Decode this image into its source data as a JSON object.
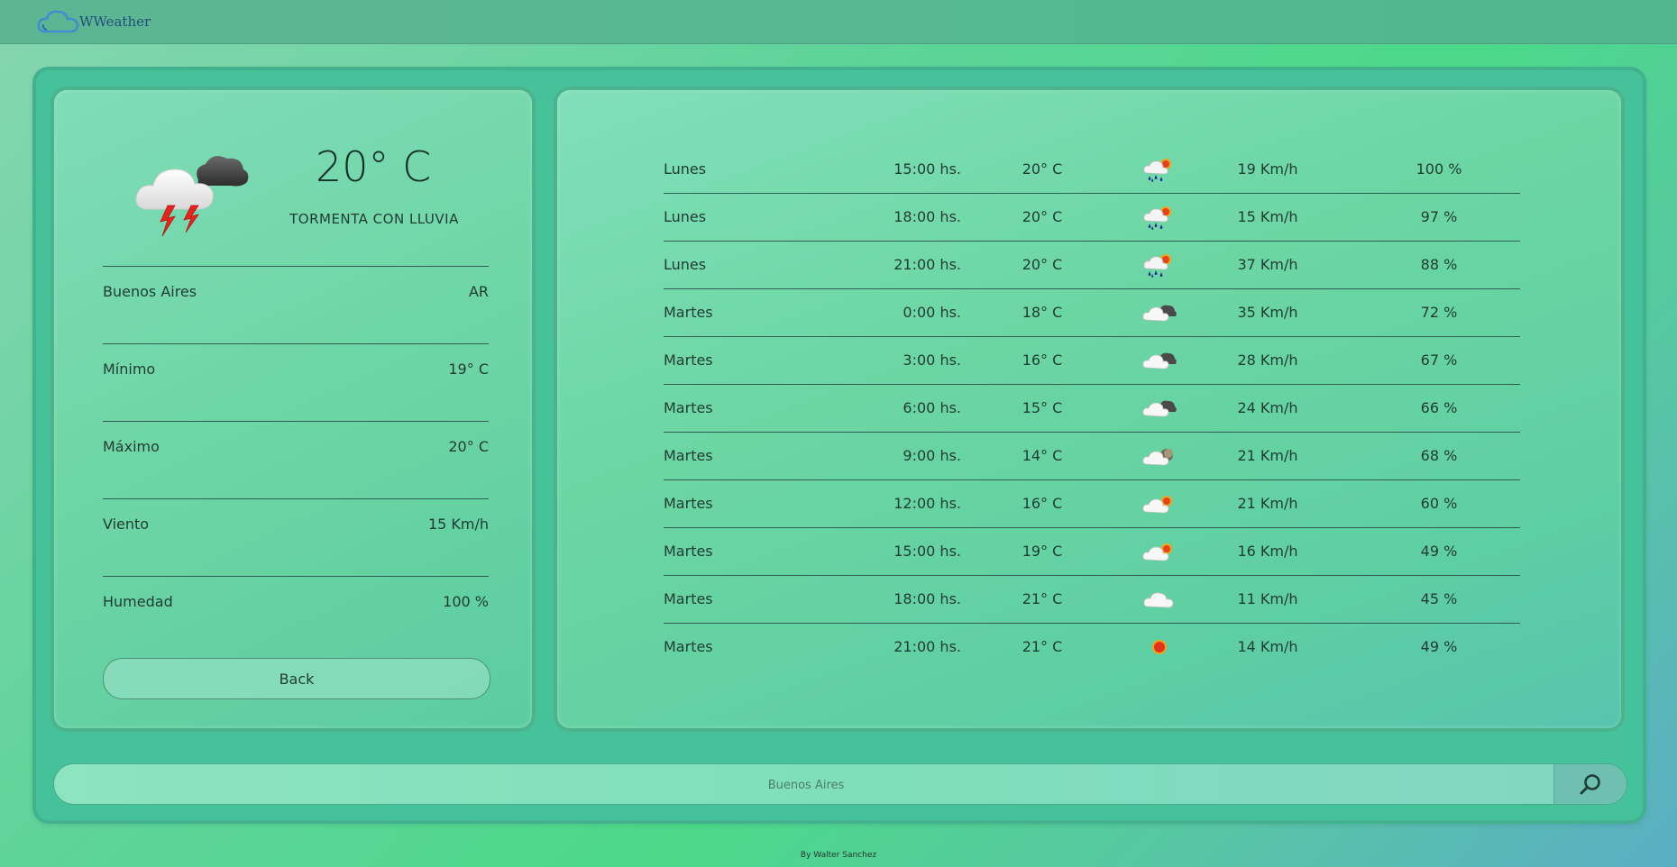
{
  "header": {
    "brand": "WWeather",
    "logo_icon": "cloud-icon"
  },
  "current": {
    "icon": "thunderstorm-icon",
    "temperature": "20° C",
    "description": "TORMENTA CON LLUVIA",
    "stats": [
      {
        "label": "Buenos Aires",
        "value": "AR"
      },
      {
        "label": "Mínimo",
        "value": "19° C"
      },
      {
        "label": "Máximo",
        "value": "20° C"
      },
      {
        "label": "Viento",
        "value": "15 Km/h"
      },
      {
        "label": "Humedad",
        "value": "100 %"
      }
    ],
    "back_label": "Back"
  },
  "forecast": [
    {
      "day": "Lunes",
      "time": "15:00 hs.",
      "temp": "20° C",
      "icon": "rain-sun-icon",
      "wind": "19 Km/h",
      "humidity": "100 %"
    },
    {
      "day": "Lunes",
      "time": "18:00 hs.",
      "temp": "20° C",
      "icon": "rain-sun-icon",
      "wind": "15 Km/h",
      "humidity": "97 %"
    },
    {
      "day": "Lunes",
      "time": "21:00 hs.",
      "temp": "20° C",
      "icon": "rain-sun-icon",
      "wind": "37 Km/h",
      "humidity": "88 %"
    },
    {
      "day": "Martes",
      "time": "0:00 hs.",
      "temp": "18° C",
      "icon": "cloudy-night-icon",
      "wind": "35 Km/h",
      "humidity": "72 %"
    },
    {
      "day": "Martes",
      "time": "3:00 hs.",
      "temp": "16° C",
      "icon": "cloudy-night-icon",
      "wind": "28 Km/h",
      "humidity": "67 %"
    },
    {
      "day": "Martes",
      "time": "6:00 hs.",
      "temp": "15° C",
      "icon": "cloudy-night-icon",
      "wind": "24 Km/h",
      "humidity": "66 %"
    },
    {
      "day": "Martes",
      "time": "9:00 hs.",
      "temp": "14° C",
      "icon": "cloudy-moon-icon",
      "wind": "21 Km/h",
      "humidity": "68 %"
    },
    {
      "day": "Martes",
      "time": "12:00 hs.",
      "temp": "16° C",
      "icon": "partly-cloudy-icon",
      "wind": "21 Km/h",
      "humidity": "60 %"
    },
    {
      "day": "Martes",
      "time": "15:00 hs.",
      "temp": "19° C",
      "icon": "partly-cloudy-icon",
      "wind": "16 Km/h",
      "humidity": "49 %"
    },
    {
      "day": "Martes",
      "time": "18:00 hs.",
      "temp": "21° C",
      "icon": "cloud-icon",
      "wind": "11 Km/h",
      "humidity": "45 %"
    },
    {
      "day": "Martes",
      "time": "21:00 hs.",
      "temp": "21° C",
      "icon": "sun-icon",
      "wind": "14 Km/h",
      "humidity": "49 %"
    }
  ],
  "search": {
    "placeholder": "Buenos Aires",
    "button_icon": "search-icon"
  },
  "footer": {
    "credit": "By Walter Sanchez"
  }
}
